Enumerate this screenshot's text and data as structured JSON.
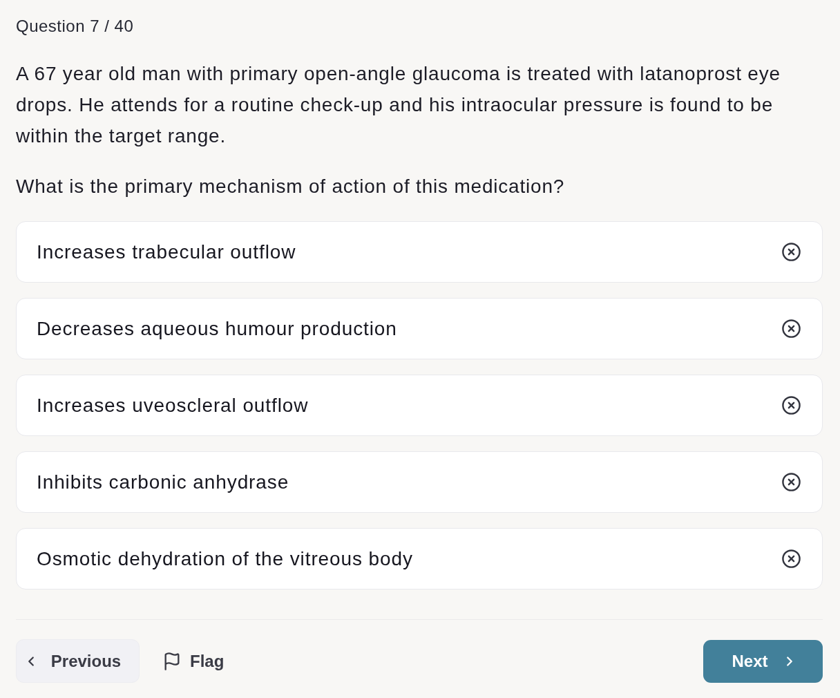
{
  "header": {
    "progress": "Question 7 / 40"
  },
  "stem": "A 67 year old man with primary open-angle glaucoma is treated with latanoprost eye drops. He attends for a routine check-up and his intraocular pressure is found to be within the target range.",
  "prompt": "What is the primary mechanism of action of this medication?",
  "options": [
    {
      "text": "Increases trabecular outflow"
    },
    {
      "text": "Decreases aqueous humour production"
    },
    {
      "text": "Increases uveoscleral outflow"
    },
    {
      "text": "Inhibits carbonic anhydrase"
    },
    {
      "text": "Osmotic dehydration of the vitreous body"
    }
  ],
  "footer": {
    "previous": "Previous",
    "flag": "Flag",
    "next": "Next"
  }
}
